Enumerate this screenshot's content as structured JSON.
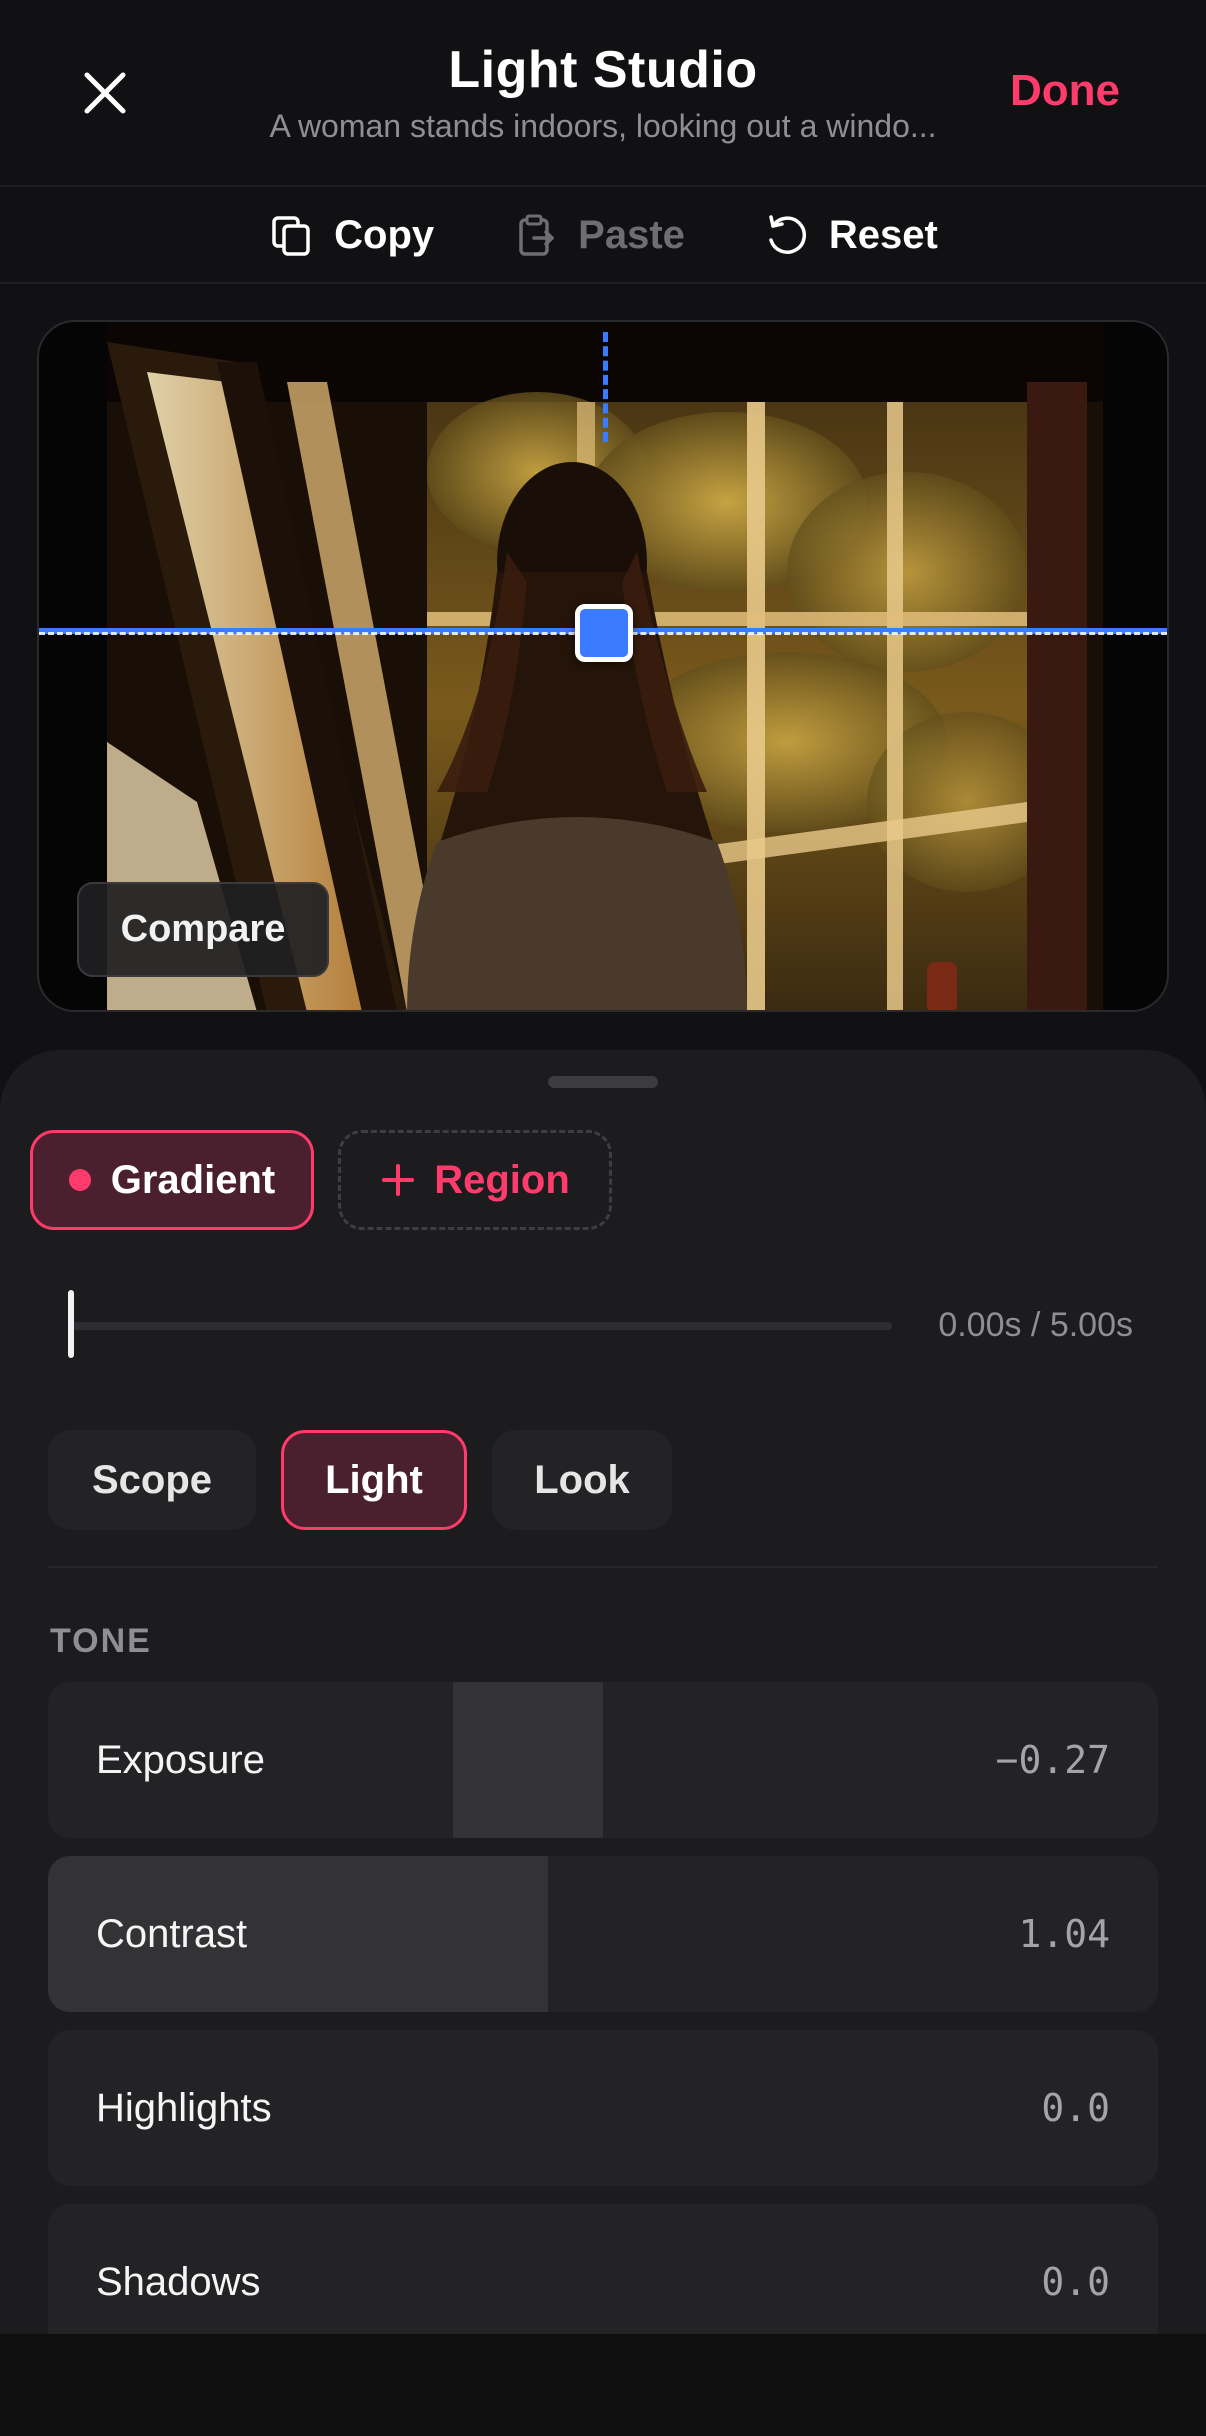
{
  "header": {
    "title": "Light Studio",
    "subtitle": "A woman stands indoors, looking out a windo...",
    "done_label": "Done"
  },
  "toolbar": {
    "copy_label": "Copy",
    "paste_label": "Paste",
    "reset_label": "Reset"
  },
  "preview": {
    "compare_label": "Compare"
  },
  "masks": {
    "gradient_label": "Gradient",
    "region_label": "Region"
  },
  "timeline": {
    "time_label": "0.00s / 5.00s",
    "progress": 0.0
  },
  "tabs": {
    "scope": "Scope",
    "light": "Light",
    "look": "Look",
    "selected": "Light"
  },
  "tone": {
    "section_label": "TONE",
    "sliders": [
      {
        "label": "Exposure",
        "value": "−0.27"
      },
      {
        "label": "Contrast",
        "value": "1.04"
      },
      {
        "label": "Highlights",
        "value": "0.0"
      },
      {
        "label": "Shadows",
        "value": "0.0"
      }
    ]
  },
  "colors": {
    "accent": "#ff3b6b",
    "mask_handle": "#3a7bff",
    "background": "#111113",
    "sheet": "#1c1c1f"
  },
  "icons": {
    "close": "close-icon",
    "copy": "copy-icon",
    "paste": "paste-icon",
    "reset": "reset-icon",
    "add": "plus-icon"
  }
}
